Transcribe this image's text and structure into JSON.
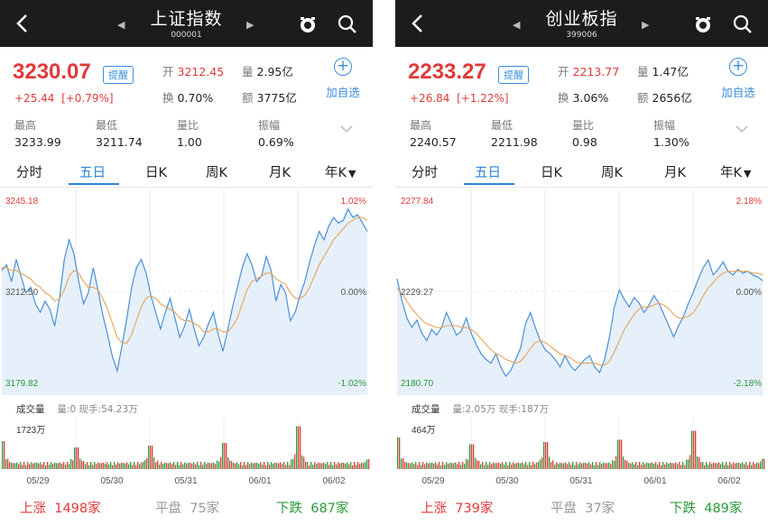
{
  "panels": [
    {
      "id": "left",
      "title": "上证指数",
      "code": "000001",
      "price": "3230.07",
      "remind_label": "提醒",
      "change": "+25.44",
      "change_pct": "[+0.79%]",
      "open_label": "开",
      "open": "3212.45",
      "volume_label": "量",
      "volume": "2.95亿",
      "turnover_rate_label": "换",
      "turnover_rate": "0.70%",
      "amount_label": "额",
      "amount": "3775亿",
      "add_label": "加自选",
      "high_label": "最高",
      "high": "3233.99",
      "low_label": "最低",
      "low": "3211.74",
      "ratio_label": "量比",
      "ratio": "1.00",
      "amplitude_label": "振幅",
      "amplitude": "0.69%",
      "tabs": [
        "分时",
        "五日",
        "日K",
        "周K",
        "月K",
        "年K"
      ],
      "active_tab": "五日",
      "vol_title": "成交量",
      "vol_info": "量:0 现手:54.23万",
      "footer": {
        "up_label": "上涨",
        "up": "1498家",
        "flat_label": "平盘",
        "flat": "75家",
        "down_label": "下跌",
        "down": "687家"
      },
      "chart_data": {
        "type": "line",
        "y_max": "3245.18",
        "y_mid": "3212.50",
        "y_min": "3179.82",
        "pct_max": "1.02%",
        "pct_mid": "0.00%",
        "pct_min": "-1.02%",
        "ylim": [
          3179.82,
          3245.18
        ],
        "x_labels": [
          "05/29",
          "05/30",
          "05/31",
          "06/01",
          "06/02"
        ],
        "price_series": [
          3220,
          3222,
          3216,
          3224,
          3218,
          3212,
          3214,
          3208,
          3205,
          3209,
          3206,
          3200,
          3210,
          3224,
          3231,
          3226,
          3216,
          3208,
          3212,
          3221,
          3213,
          3204,
          3197,
          3189,
          3184,
          3193,
          3203,
          3214,
          3221,
          3224,
          3219,
          3211,
          3205,
          3199,
          3205,
          3210,
          3203,
          3196,
          3200,
          3206,
          3199,
          3193,
          3196,
          3201,
          3205,
          3197,
          3191,
          3199,
          3207,
          3214,
          3221,
          3226,
          3222,
          3216,
          3218,
          3225,
          3220,
          3209,
          3215,
          3212,
          3202,
          3205,
          3211,
          3216,
          3223,
          3229,
          3234,
          3231,
          3236,
          3239,
          3237,
          3238,
          3242,
          3239,
          3240,
          3237,
          3234
        ],
        "ma_series": [
          3221,
          3221,
          3220,
          3220,
          3219,
          3218,
          3217,
          3215,
          3214,
          3212,
          3211,
          3209,
          3210,
          3213,
          3218,
          3220,
          3219,
          3216,
          3214,
          3214,
          3213,
          3210,
          3206,
          3201,
          3196,
          3194,
          3194,
          3197,
          3202,
          3207,
          3210,
          3211,
          3210,
          3208,
          3207,
          3206,
          3205,
          3203,
          3202,
          3202,
          3201,
          3200,
          3198,
          3198,
          3199,
          3199,
          3198,
          3198,
          3200,
          3203,
          3208,
          3213,
          3216,
          3217,
          3218,
          3219,
          3219,
          3217,
          3216,
          3215,
          3212,
          3210,
          3210,
          3211,
          3214,
          3218,
          3222,
          3225,
          3228,
          3231,
          3233,
          3235,
          3237,
          3238,
          3239,
          3239,
          3238
        ],
        "volume_max_label": "1723万",
        "volume_peaks": [
          0.62,
          0.48,
          0.52,
          0.58,
          0.95,
          0.55
        ]
      }
    },
    {
      "id": "right",
      "title": "创业板指",
      "code": "399006",
      "price": "2233.27",
      "remind_label": "提醒",
      "change": "+26.84",
      "change_pct": "[+1.22%]",
      "open_label": "开",
      "open": "2213.77",
      "volume_label": "量",
      "volume": "1.47亿",
      "turnover_rate_label": "换",
      "turnover_rate": "3.06%",
      "amount_label": "额",
      "amount": "2656亿",
      "add_label": "加自选",
      "high_label": "最高",
      "high": "2240.57",
      "low_label": "最低",
      "low": "2211.98",
      "ratio_label": "量比",
      "ratio": "0.98",
      "amplitude_label": "振幅",
      "amplitude": "1.30%",
      "tabs": [
        "分时",
        "五日",
        "日K",
        "周K",
        "月K",
        "年K"
      ],
      "active_tab": "五日",
      "vol_title": "成交量",
      "vol_info": "量:2.05万 现手:187万",
      "footer": {
        "up_label": "上涨",
        "up": "739家",
        "flat_label": "平盘",
        "flat": "37家",
        "down_label": "下跌",
        "down": "489家"
      },
      "chart_data": {
        "type": "line",
        "y_max": "2277.84",
        "y_mid": "2229.27",
        "y_min": "2180.70",
        "pct_max": "2.18%",
        "pct_mid": "0.00%",
        "pct_min": "-2.18%",
        "ylim": [
          2180.7,
          2277.84
        ],
        "x_labels": [
          "05/29",
          "05/30",
          "05/31",
          "06/01",
          "06/02"
        ],
        "price_series": [
          2236,
          2224,
          2215,
          2210,
          2214,
          2207,
          2203,
          2209,
          2206,
          2210,
          2218,
          2212,
          2206,
          2208,
          2215,
          2207,
          2201,
          2196,
          2193,
          2191,
          2196,
          2189,
          2184,
          2187,
          2193,
          2199,
          2212,
          2218,
          2210,
          2203,
          2198,
          2196,
          2193,
          2189,
          2195,
          2190,
          2187,
          2190,
          2193,
          2195,
          2189,
          2186,
          2193,
          2205,
          2221,
          2230,
          2225,
          2221,
          2226,
          2223,
          2218,
          2222,
          2227,
          2223,
          2217,
          2211,
          2205,
          2211,
          2216,
          2223,
          2229,
          2236,
          2242,
          2246,
          2238,
          2241,
          2245,
          2240,
          2238,
          2241,
          2239,
          2240,
          2238,
          2237,
          2235
        ],
        "ma_series": [
          2231,
          2228,
          2224,
          2220,
          2217,
          2214,
          2212,
          2211,
          2210,
          2210,
          2211,
          2211,
          2211,
          2210,
          2210,
          2209,
          2207,
          2204,
          2201,
          2198,
          2196,
          2195,
          2193,
          2192,
          2191,
          2192,
          2195,
          2199,
          2202,
          2203,
          2202,
          2200,
          2198,
          2196,
          2195,
          2194,
          2192,
          2191,
          2191,
          2191,
          2191,
          2190,
          2190,
          2192,
          2197,
          2203,
          2209,
          2213,
          2217,
          2220,
          2221,
          2221,
          2222,
          2223,
          2222,
          2220,
          2217,
          2215,
          2215,
          2216,
          2218,
          2222,
          2227,
          2231,
          2234,
          2237,
          2239,
          2240,
          2240,
          2240,
          2240,
          2240,
          2239,
          2239,
          2238
        ],
        "volume_max_label": "464万",
        "volume_peaks": [
          0.7,
          0.55,
          0.6,
          0.65,
          0.85,
          0.6
        ]
      }
    }
  ],
  "colors": {
    "up": "#e03a3a",
    "down": "#2a9a3a",
    "accent": "#2f86d6",
    "price_line": "#4a90d9",
    "ma_line": "#e8a35a",
    "fill": "#e6f0fb",
    "flat": "#999999",
    "topbar": "#1c1c1e"
  },
  "icons": [
    "back-arrow-icon",
    "prev-triangle-icon",
    "next-triangle-icon",
    "alarm-icon",
    "search-icon",
    "plus-circle-icon",
    "chevron-down-icon",
    "dropdown-triangle-icon"
  ]
}
